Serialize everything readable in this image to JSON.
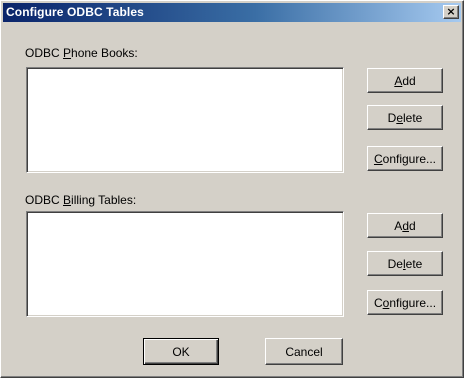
{
  "window": {
    "title": "Configure ODBC Tables",
    "close_glyph": "×"
  },
  "phone_books": {
    "label_pre": "ODBC ",
    "label_acc": "P",
    "label_post": "hone Books:",
    "items": [],
    "add": {
      "pre": "",
      "acc": "A",
      "post": "dd"
    },
    "delete": {
      "pre": "D",
      "acc": "e",
      "post": "lete"
    },
    "configure": {
      "pre": "",
      "acc": "C",
      "post": "onfigure..."
    }
  },
  "billing_tables": {
    "label_pre": "ODBC ",
    "label_acc": "B",
    "label_post": "illing Tables:",
    "items": [],
    "add": {
      "pre": "A",
      "acc": "d",
      "post": "d"
    },
    "delete": {
      "pre": "De",
      "acc": "l",
      "post": "ete"
    },
    "configure": {
      "pre": "C",
      "acc": "o",
      "post": "nfigure..."
    }
  },
  "footer": {
    "ok_label": "OK",
    "cancel_label": "Cancel"
  }
}
